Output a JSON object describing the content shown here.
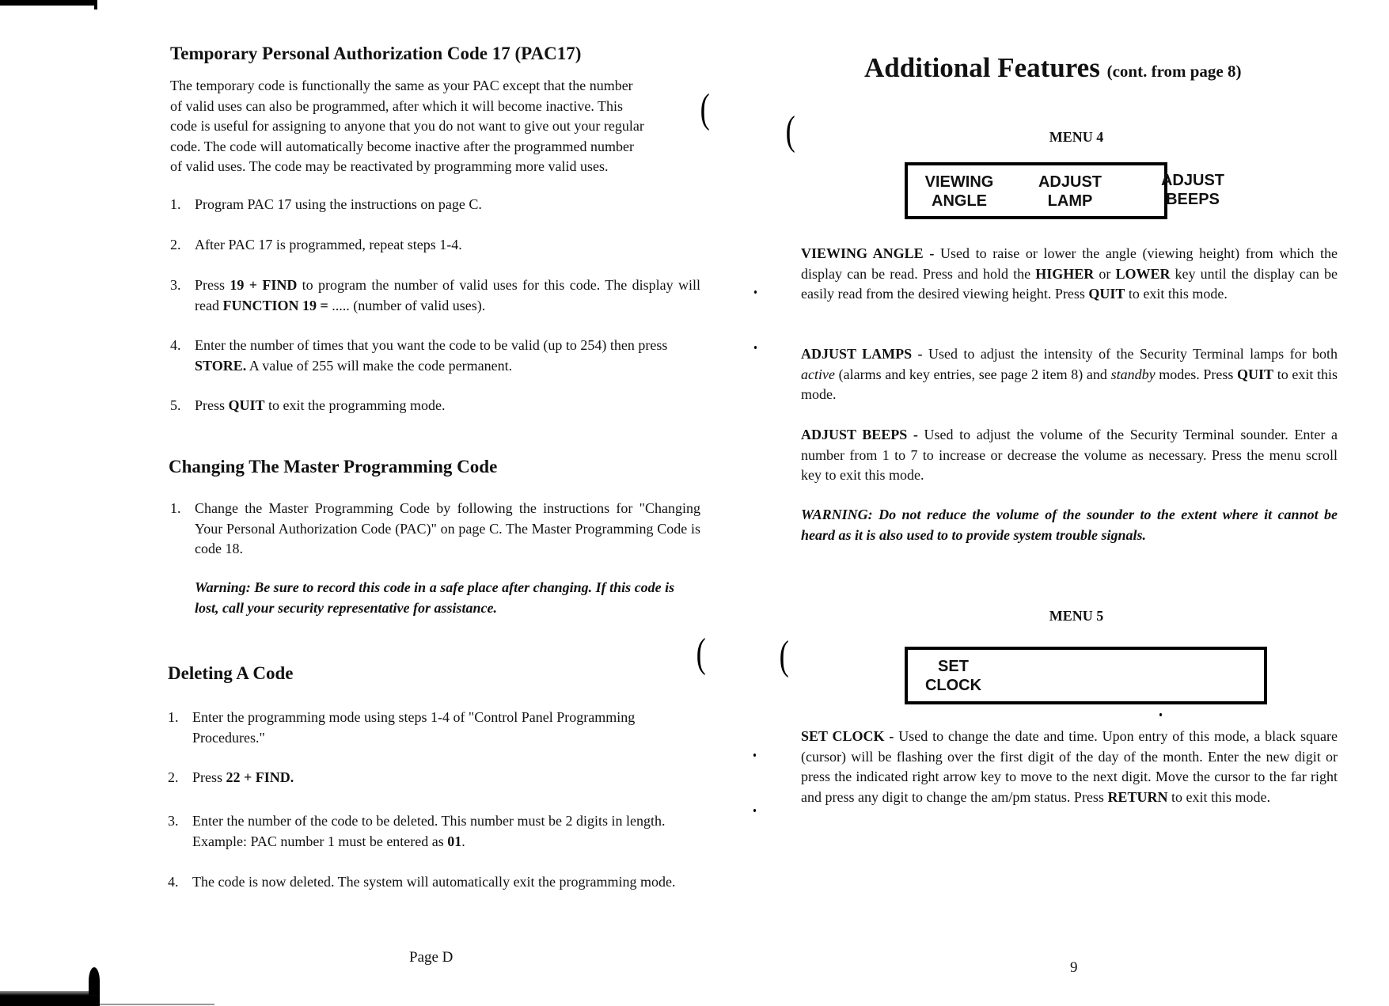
{
  "left_page": {
    "sections": [
      {
        "heading": "Temporary Personal Authorization Code 17 (PAC17)",
        "intro_lines": [
          "The temporary code is functionally the same as your PAC except that the number",
          "of valid uses can also be programmed, after which it will become inactive.  This",
          "code is useful for assigning to anyone that you do not want to give out your regular",
          "code.  The code will automatically become inactive after the programmed number",
          "of valid uses.   The code may be reactivated by programming more valid uses."
        ],
        "steps": [
          {
            "num": "1.",
            "parts": [
              {
                "t": "Program PAC 17 using the instructions on page C."
              }
            ]
          },
          {
            "num": "2.",
            "parts": [
              {
                "t": "After PAC 17 is programmed, repeat steps 1-4."
              }
            ]
          },
          {
            "num": "3.",
            "parts": [
              {
                "t": "Press "
              },
              {
                "t": "19  +  FIND",
                "b": true
              },
              {
                "t": "  to program the number of valid uses for  this code.  The display will read "
              },
              {
                "t": "FUNCTION 19 =",
                "b": true
              },
              {
                "t": " ..... (number of valid uses)."
              }
            ]
          },
          {
            "num": "4.",
            "parts": [
              {
                "t": "Enter the number of times that you want the code to be valid (up to 254) then press "
              },
              {
                "t": "STORE.",
                "b": true
              },
              {
                "t": "  A value of 255 will make the code permanent."
              }
            ]
          },
          {
            "num": "5.",
            "parts": [
              {
                "t": "Press "
              },
              {
                "t": "QUIT",
                "b": true
              },
              {
                "t": " to exit the programming mode."
              }
            ]
          }
        ]
      },
      {
        "heading": "Changing The Master Programming Code",
        "steps": [
          {
            "num": "1.",
            "parts": [
              {
                "t": "Change the Master Programming Code by following the instructions for \"Changing Your Personal Authorization Code (PAC)\" on page C.  The Master Programming Code is code 18."
              }
            ]
          }
        ],
        "warning": "Warning:  Be sure to record this code in a safe place after changing.  If this code is lost,  call your security representative for assistance."
      },
      {
        "heading": "Deleting A Code",
        "steps": [
          {
            "num": "1.",
            "parts": [
              {
                "t": "Enter the programming mode using steps 1-4 of \"Control Panel Programming Procedures.\""
              }
            ]
          },
          {
            "num": "2.",
            "parts": [
              {
                "t": "Press "
              },
              {
                "t": "22  +  FIND.",
                "b": true
              }
            ]
          },
          {
            "num": "3.",
            "parts": [
              {
                "t": "Enter the number of the code to be deleted.  This number must be 2 digits in length.  Example: PAC number 1 must be entered as "
              },
              {
                "t": "01",
                "b": true
              },
              {
                "t": "."
              }
            ]
          },
          {
            "num": "4.",
            "parts": [
              {
                "t": "The code is now deleted.  The system will automatically exit the programming mode."
              }
            ]
          }
        ]
      }
    ],
    "footer": "Page D"
  },
  "right_page": {
    "title": "Additional Features",
    "title_sub": "(cont. from page 8)",
    "menu4": {
      "label": "MENU 4",
      "items": [
        {
          "line1": "VIEWING",
          "line2": "ANGLE"
        },
        {
          "line1": "ADJUST",
          "line2": "LAMP"
        },
        {
          "line1": "ADJUST",
          "line2": "BEEPS"
        }
      ]
    },
    "descriptions": [
      {
        "parts": [
          {
            "t": "VIEWING ANGLE - ",
            "b": true
          },
          {
            "t": "Used to raise or lower the angle (viewing height) from which the display can be read.  Press and hold the "
          },
          {
            "t": "HIGHER",
            "b": true
          },
          {
            "t": " or "
          },
          {
            "t": "LOWER",
            "b": true
          },
          {
            "t": " key until the display can be easily read from the desired viewing height.  Press "
          },
          {
            "t": "QUIT",
            "b": true
          },
          {
            "t": " to exit this mode."
          }
        ]
      },
      {
        "parts": [
          {
            "t": "ADJUST LAMPS - ",
            "b": true
          },
          {
            "t": "Used to adjust the intensity of the Security Terminal lamps for both "
          },
          {
            "t": "active",
            "i": true
          },
          {
            "t": " (alarms and key entries, see page 2  item 8)  and "
          },
          {
            "t": "standby",
            "i": true
          },
          {
            "t": "  modes.  Press "
          },
          {
            "t": "QUIT",
            "b": true
          },
          {
            "t": " to exit this mode."
          }
        ]
      },
      {
        "parts": [
          {
            "t": "ADJUST BEEPS - ",
            "b": true
          },
          {
            "t": "Used to adjust the volume of the Security Terminal sounder. Enter a number from 1 to 7 to increase or decrease the volume as necessary.  Press the menu scroll key to exit this mode."
          }
        ]
      },
      {
        "parts": [
          {
            "t": "WARNING:  Do not reduce the volume of the sounder to the extent where it cannot be heard as it is also used to to provide system trouble signals.",
            "b": true,
            "i": true
          }
        ]
      }
    ],
    "menu5": {
      "label": "MENU 5",
      "items": [
        {
          "line1": "SET",
          "line2": "CLOCK"
        }
      ]
    },
    "set_clock": {
      "parts": [
        {
          "t": "SET CLOCK - ",
          "b": true
        },
        {
          "t": "Used to change the date and time.  Upon entry of this mode, a black square (cursor) will be flashing over the first digit of the day of the month.  Enter the new digit or press the indicated right arrow key to move to the next digit. Move the cursor to the far right and press any digit to change the am/pm status.  Press "
        },
        {
          "t": "RETURN",
          "b": true
        },
        {
          "t": " to exit this mode."
        }
      ]
    },
    "footer": "9"
  }
}
